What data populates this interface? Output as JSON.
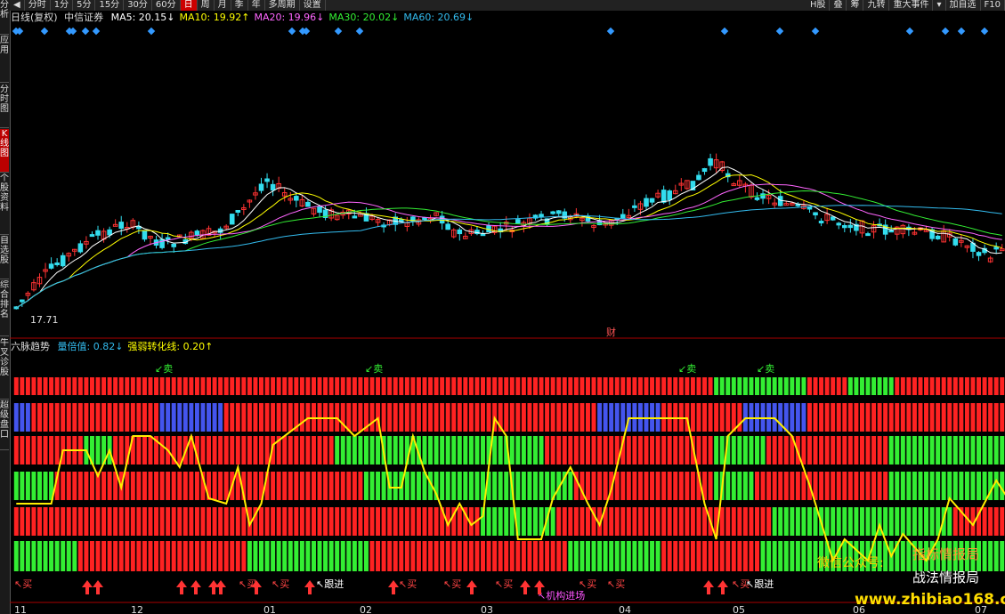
{
  "sidebar": {
    "tabs": [
      {
        "label": "分析",
        "active": false
      },
      {
        "label": "应用",
        "active": false
      },
      {
        "label": "分时图",
        "active": false
      },
      {
        "label": "K线图",
        "active": true
      },
      {
        "label": "个股资料",
        "active": false
      },
      {
        "label": "自选股",
        "active": false
      },
      {
        "label": "综合排名",
        "active": false
      },
      {
        "label": "牛叉诊股",
        "active": false
      },
      {
        "label": "超级盘口",
        "active": false
      }
    ]
  },
  "toolbar": {
    "periods": [
      {
        "label": "分时",
        "active": false
      },
      {
        "label": "1分",
        "active": false
      },
      {
        "label": "5分",
        "active": false
      },
      {
        "label": "15分",
        "active": false
      },
      {
        "label": "30分",
        "active": false
      },
      {
        "label": "60分",
        "active": false
      },
      {
        "label": "日",
        "active": true
      },
      {
        "label": "周",
        "active": false
      },
      {
        "label": "月",
        "active": false
      },
      {
        "label": "季",
        "active": false
      },
      {
        "label": "年",
        "active": false
      },
      {
        "label": "多周期",
        "active": false
      },
      {
        "label": "设置",
        "active": false
      }
    ],
    "right": [
      "H股",
      "叠",
      "筹",
      "九转",
      "重大事件",
      "▾",
      "加自选",
      "F10"
    ]
  },
  "kline": {
    "period_label": "日线(复权)",
    "stock_name": "中信证券",
    "ma": [
      {
        "label": "MA5: 20.15",
        "arrow": "↓",
        "color": "#ffffff"
      },
      {
        "label": "MA10: 19.92",
        "arrow": "↑",
        "color": "#ffff00"
      },
      {
        "label": "MA20: 19.96",
        "arrow": "↓",
        "color": "#ff66ff"
      },
      {
        "label": "MA30: 20.02",
        "arrow": "↓",
        "color": "#33ee33"
      },
      {
        "label": "MA60: 20.69",
        "arrow": "↓",
        "color": "#33bbee"
      }
    ],
    "low_label": "17.71",
    "event_label": "财"
  },
  "indicator": {
    "name": "六脉趋势",
    "params": [
      {
        "label": "量倍值: 0.82",
        "arrow": "↓",
        "color": "#33bbee"
      },
      {
        "label": "强弱转化线: 0.20",
        "arrow": "↑",
        "color": "#ffff00"
      }
    ],
    "sell_label": "卖",
    "buy_label": "买",
    "follow_label": "跟进",
    "inst_label": "机构进场"
  },
  "xaxis": {
    "labels": [
      "11",
      "12",
      "01",
      "02",
      "03",
      "04",
      "05",
      "06",
      "07"
    ]
  },
  "watermark": {
    "line1": "指标情报局",
    "line2": "战法情报局",
    "wechat": "微信公众号:",
    "site": "www.zhibiao168.com"
  }
}
